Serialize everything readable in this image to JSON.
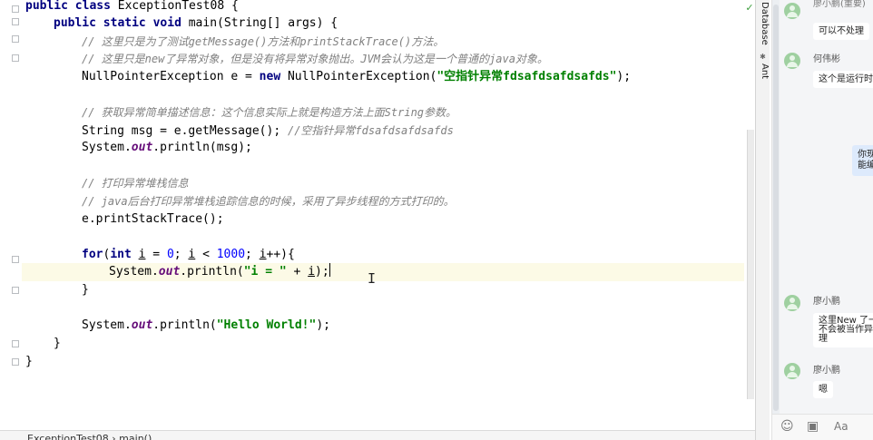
{
  "editor": {
    "lines": {
      "l1": {
        "kw1": "public",
        "kw2": "class",
        "name": " ExceptionTest08 {"
      },
      "l2": {
        "kw1": "public",
        "kw2": "static",
        "kw3": "void",
        "rest": " main(String[] args) {"
      },
      "l3": {
        "comment": "// 这里只是为了测试getMessage()方法和printStackTrace()方法。"
      },
      "l4": {
        "comment": "// 这里只是new了异常对象，但是没有将异常对象抛出。JVM会认为这是一个普通的java对象。"
      },
      "l5": {
        "pre": "NullPointerException e = ",
        "kw": "new",
        "mid": " NullPointerException(",
        "str": "\"空指针异常fdsafdsafdsafds\"",
        "post": ");"
      },
      "l7": {
        "comment": "// 获取异常简单描述信息：这个信息实际上就是构造方法上面String参数。"
      },
      "l8": {
        "code": "String msg = e.getMessage(); ",
        "comment": "//空指针异常fdsafdsafdsafds"
      },
      "l9": {
        "pre": "System.",
        "field": "out",
        "post": ".println(msg);"
      },
      "l11": {
        "comment": "// 打印异常堆栈信息"
      },
      "l12": {
        "comment": "// java后台打印异常堆栈追踪信息的时候，采用了异步线程的方式打印的。"
      },
      "l13": {
        "code": "e.printStackTrace();"
      },
      "l15": {
        "kw1": "for",
        "p1": "(",
        "kw2": "int",
        "v1": "i",
        "p2": " = ",
        "n1": "0",
        "p3": "; ",
        "v2": "i",
        "p4": " < ",
        "n2": "1000",
        "p5": "; ",
        "v3": "i",
        "p6": "++){"
      },
      "l16": {
        "pre": "System.",
        "field": "out",
        "mid": ".println(",
        "str": "\"i = \"",
        "op": " + ",
        "v": "i",
        "post": ");"
      },
      "l17": {
        "code": "}"
      },
      "l19": {
        "pre": "System.",
        "field": "out",
        "mid": ".println(",
        "str": "\"Hello World!\"",
        "post": ");"
      },
      "l20": {
        "code": "}"
      },
      "l21": {
        "code": "}"
      }
    }
  },
  "breadcrumb": {
    "text": "ExceptionTest08 › main()"
  },
  "tool_strip": {
    "database_tab": "Database",
    "ant_tab": "Ant"
  },
  "chat": {
    "top_fragments": {
      "left": "廖小鹏",
      "right": "(重要)"
    },
    "messages": [
      {
        "sender": "",
        "text": "可以不处理"
      },
      {
        "sender": "何伟彬",
        "text": "这个是运行时"
      },
      {
        "self_text_1": "你现",
        "self_text_2": "能编"
      },
      {
        "sender": "廖小鹏",
        "text_1": "这里New 了一",
        "text_2": "不会被当作异",
        "text_3": "理"
      },
      {
        "sender": "廖小鹏",
        "text": "嗯"
      }
    ],
    "toolbar": {
      "emoji_icon": "☺",
      "image_icon": "▣",
      "font_icon": "Aa"
    }
  }
}
